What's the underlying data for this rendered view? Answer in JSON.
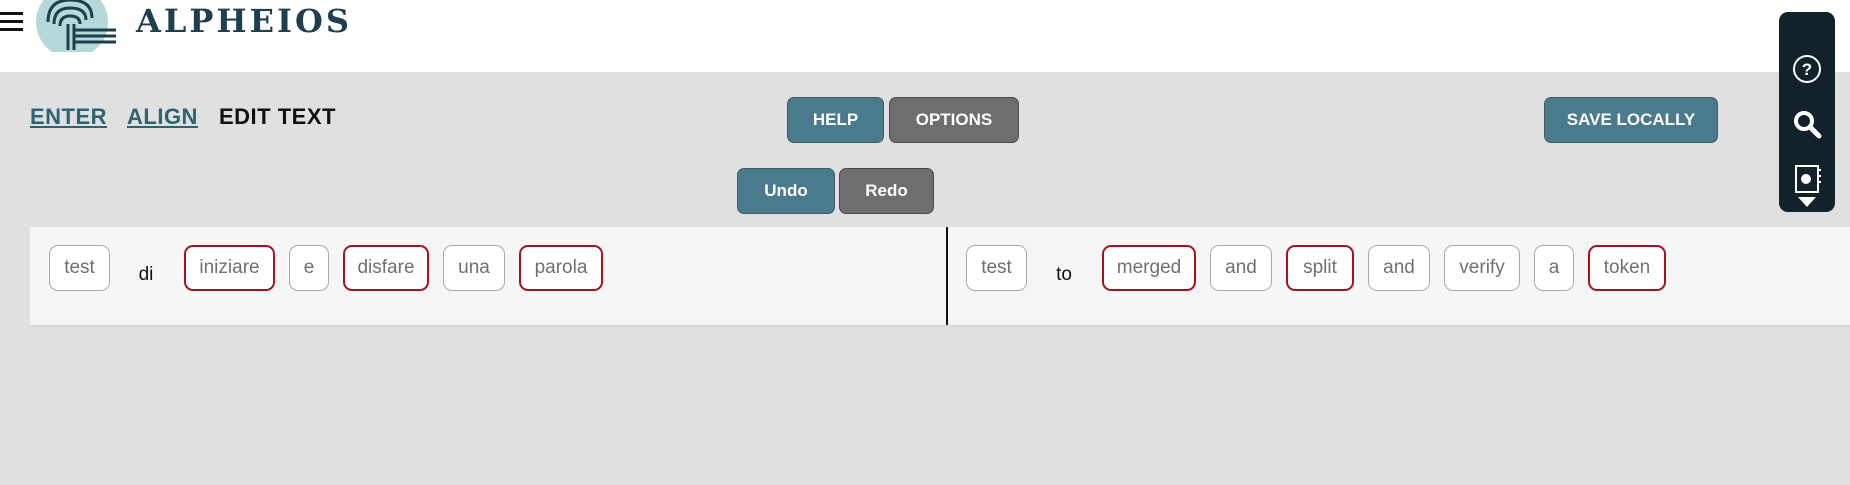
{
  "header": {
    "logo_text": "ALPHEIOS"
  },
  "nav": {
    "enter": "ENTER",
    "align": "ALIGN",
    "edit_text": "EDIT TEXT"
  },
  "toolbar": {
    "help": "HELP",
    "options": "OPTIONS",
    "save_locally": "SAVE LOCALLY",
    "undo": "Undo",
    "redo": "Redo"
  },
  "origin_tokens": [
    "test",
    "di",
    "iniziare",
    "e",
    "disfare",
    "una",
    "parola"
  ],
  "target_tokens": [
    "test",
    "to",
    "merged",
    "and",
    "split",
    "and",
    "verify",
    "a",
    "token"
  ],
  "colors": {
    "accent": "#4a7b8d",
    "secondary": "#6e6e6e",
    "token_highlight": "#a3151b",
    "sidebar": "#12212a",
    "logo": "#1f3e4e"
  },
  "side_panel": {
    "icons": [
      "help-icon",
      "search-icon",
      "inflections-browser-icon",
      "chevron-down-icon"
    ]
  }
}
